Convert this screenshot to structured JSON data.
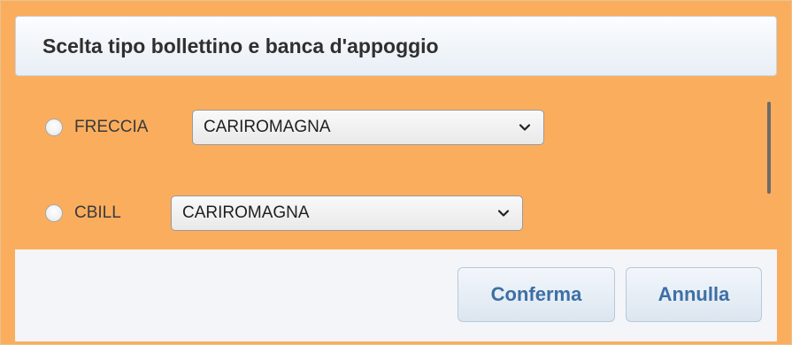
{
  "dialog": {
    "title": "Scelta tipo bollettino e banca d'appoggio"
  },
  "options": [
    {
      "label": "FRECCIA",
      "selected": false,
      "bank": "CARIROMAGNA"
    },
    {
      "label": "CBILL",
      "selected": false,
      "bank": "CARIROMAGNA"
    }
  ],
  "buttons": {
    "confirm": "Conferma",
    "cancel": "Annulla"
  },
  "colors": {
    "panel_background": "#fbad5e",
    "title_background": "#eef3f9",
    "button_text": "#3d6fa5"
  }
}
